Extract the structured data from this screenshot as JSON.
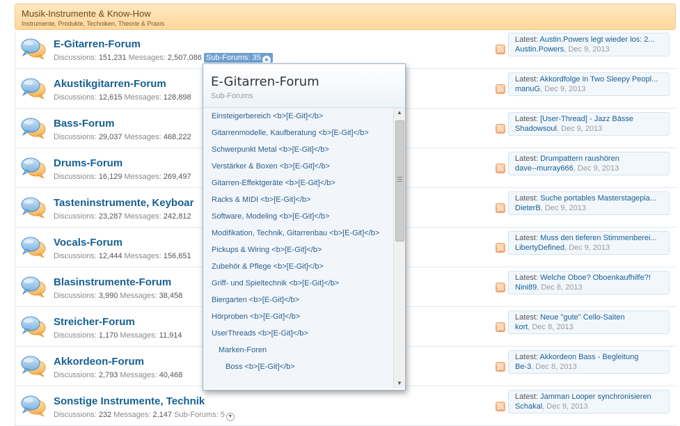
{
  "category": {
    "title": "Musik-Instrumente & Know-How",
    "description": "Instrumente, Produkte, Techniken, Theorie & Praxis"
  },
  "labels": {
    "discussions": "Discussions:",
    "messages": "Messages:",
    "subforums": "Sub-Forums:",
    "latest": "Latest:"
  },
  "forums": [
    {
      "title": "E-Gitarren-Forum",
      "discussions": "151,231",
      "messages": "2,507,086",
      "subforums": "35",
      "latest_title": "Austin.Powers legt wieder los: 2...",
      "latest_user": "Austin.Powers",
      "latest_date": "Dec 9, 2013"
    },
    {
      "title": "Akustikgitarren-Forum",
      "discussions": "12,615",
      "messages": "128,898",
      "subforums": "",
      "latest_title": "Akkordfolge in Two Sleepy Peopl...",
      "latest_user": "manuG",
      "latest_date": "Dec 9, 2013"
    },
    {
      "title": "Bass-Forum",
      "discussions": "29,037",
      "messages": "468,222",
      "subforums": "",
      "latest_title": "[User-Thread] - Jazz Bässe",
      "latest_user": "Shadowsoul",
      "latest_date": "Dec 9, 2013"
    },
    {
      "title": "Drums-Forum",
      "discussions": "16,129",
      "messages": "269,497",
      "subforums": "",
      "latest_title": "Drumpattern raushören",
      "latest_user": "dave--murray666",
      "latest_date": "Dec 9, 2013"
    },
    {
      "title": "Tasteninstrumente, Keyboar",
      "discussions": "23,287",
      "messages": "242,812",
      "subforums": "",
      "latest_title": "Suche portables Masterstagepia...",
      "latest_user": "DieterB",
      "latest_date": "Dec 9, 2013"
    },
    {
      "title": "Vocals-Forum",
      "discussions": "12,444",
      "messages": "156,651",
      "subforums": "",
      "latest_title": "Muss den tieferen Stimmenberei...",
      "latest_user": "LibertyDefined",
      "latest_date": "Dec 9, 2013"
    },
    {
      "title": "Blasinstrumente-Forum",
      "discussions": "3,990",
      "messages": "38,458",
      "subforums": "",
      "latest_title": "Welche Oboe? Oboenkaufhilfe?!",
      "latest_user": "Nini89",
      "latest_date": "Dec 8, 2013"
    },
    {
      "title": "Streicher-Forum",
      "discussions": "1,170",
      "messages": "11,914",
      "subforums": "",
      "latest_title": "Neue \"gute\" Cello-Saiten",
      "latest_user": "kort",
      "latest_date": "Dec 8, 2013"
    },
    {
      "title": "Akkordeon-Forum",
      "discussions": "2,793",
      "messages": "40,468",
      "subforums": "",
      "latest_title": "Akkordeon Bass - Begleitung",
      "latest_user": "Be-3",
      "latest_date": "Dec 8, 2013"
    },
    {
      "title": "Sonstige Instrumente, Technik",
      "discussions": "232",
      "messages": "2,147",
      "subforums": "5",
      "latest_title": "Jamman Looper synchronisieren",
      "latest_user": "Schakal",
      "latest_date": "Dec 9, 2013"
    }
  ],
  "popup": {
    "title": "E-Gitarren-Forum",
    "subtitle": "Sub-Forums",
    "items": [
      {
        "label": "Einsteigerbereich <b>[E-Git]</b>",
        "level": 0
      },
      {
        "label": "Gitarrenmodelle, Kaufberatung <b>[E-Git]</b>",
        "level": 0
      },
      {
        "label": "Schwerpunkt Metal <b>[E-Git]</b>",
        "level": 0
      },
      {
        "label": "Verstärker & Boxen <b>[E-Git]</b>",
        "level": 0
      },
      {
        "label": "Gitarren-Effektgeräte <b>[E-Git]</b>",
        "level": 0
      },
      {
        "label": "Racks & MIDI <b>[E-Git]</b>",
        "level": 0
      },
      {
        "label": "Software, Modeling <b>[E-Git]</b>",
        "level": 0
      },
      {
        "label": "Modifikation, Technik, Gitarrenbau <b>[E-Git]</b>",
        "level": 0
      },
      {
        "label": "Pickups & Wiring <b>[E-Git]</b>",
        "level": 0
      },
      {
        "label": "Zubehör & Pflege <b>[E-Git]</b>",
        "level": 0
      },
      {
        "label": "Griff- und Spieltechnik <b>[E-Git]</b>",
        "level": 0
      },
      {
        "label": "Biergarten <b>[E-Git]</b>",
        "level": 0
      },
      {
        "label": "Hörproben <b>[E-Git]</b>",
        "level": 0
      },
      {
        "label": "UserThreads <b>[E-Git]</b>",
        "level": 0
      },
      {
        "label": "Marken-Foren",
        "level": 1
      },
      {
        "label": "Boss <b>[E-Git]</b>",
        "level": 2
      }
    ]
  },
  "colors": {
    "link": "#176093",
    "category_bg": "#ffd79b",
    "subforum_active": "#6e9fd0"
  }
}
